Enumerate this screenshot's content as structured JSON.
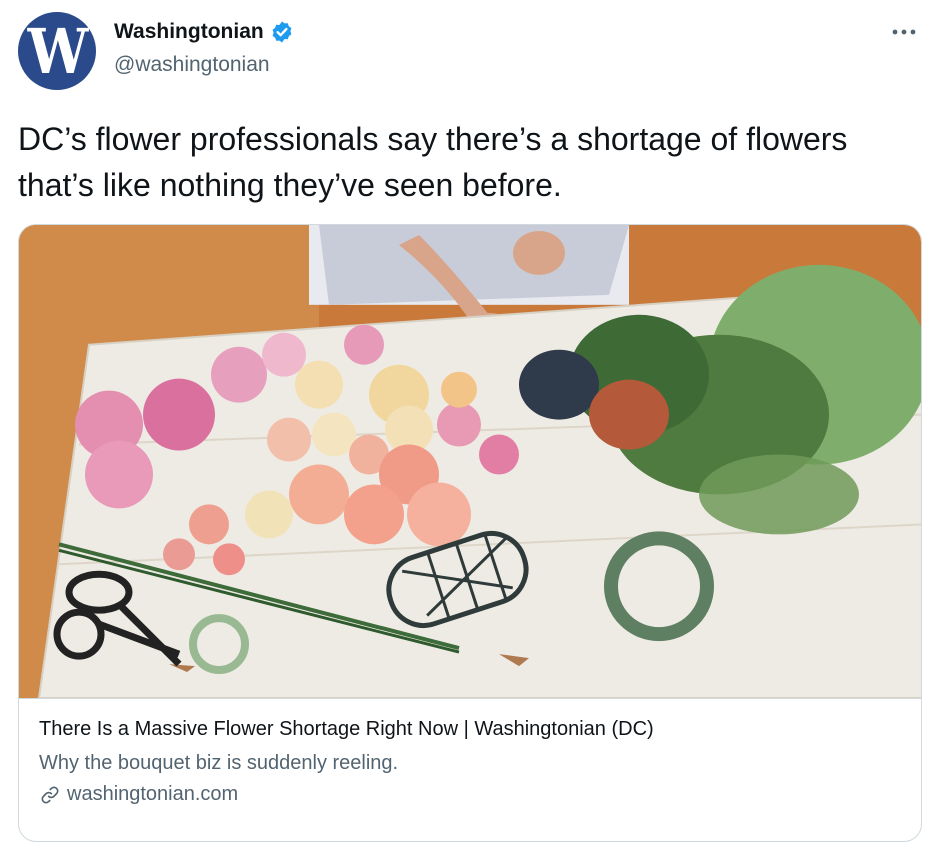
{
  "author": {
    "avatar_letter": "W",
    "display_name": "Washingtonian",
    "handle": "@washingtonian",
    "verified_icon": "verified-badge-icon",
    "brand_color": "#2a4a8c"
  },
  "tweet": {
    "text": "DC’s flower professionals say there’s a shortage of flowers that’s like nothing they’ve seen before."
  },
  "card": {
    "title": "There Is a Massive Flower Shortage Right Now | Washingtonian (DC)",
    "description": "Why the bouquet biz is suddenly reeling.",
    "domain": "washingtonian.com",
    "link_icon": "link-icon"
  },
  "more_icon": "more-options-icon",
  "colors": {
    "verified": "#1d9bf0",
    "secondary_text": "#536471",
    "border": "#cfd9de"
  }
}
